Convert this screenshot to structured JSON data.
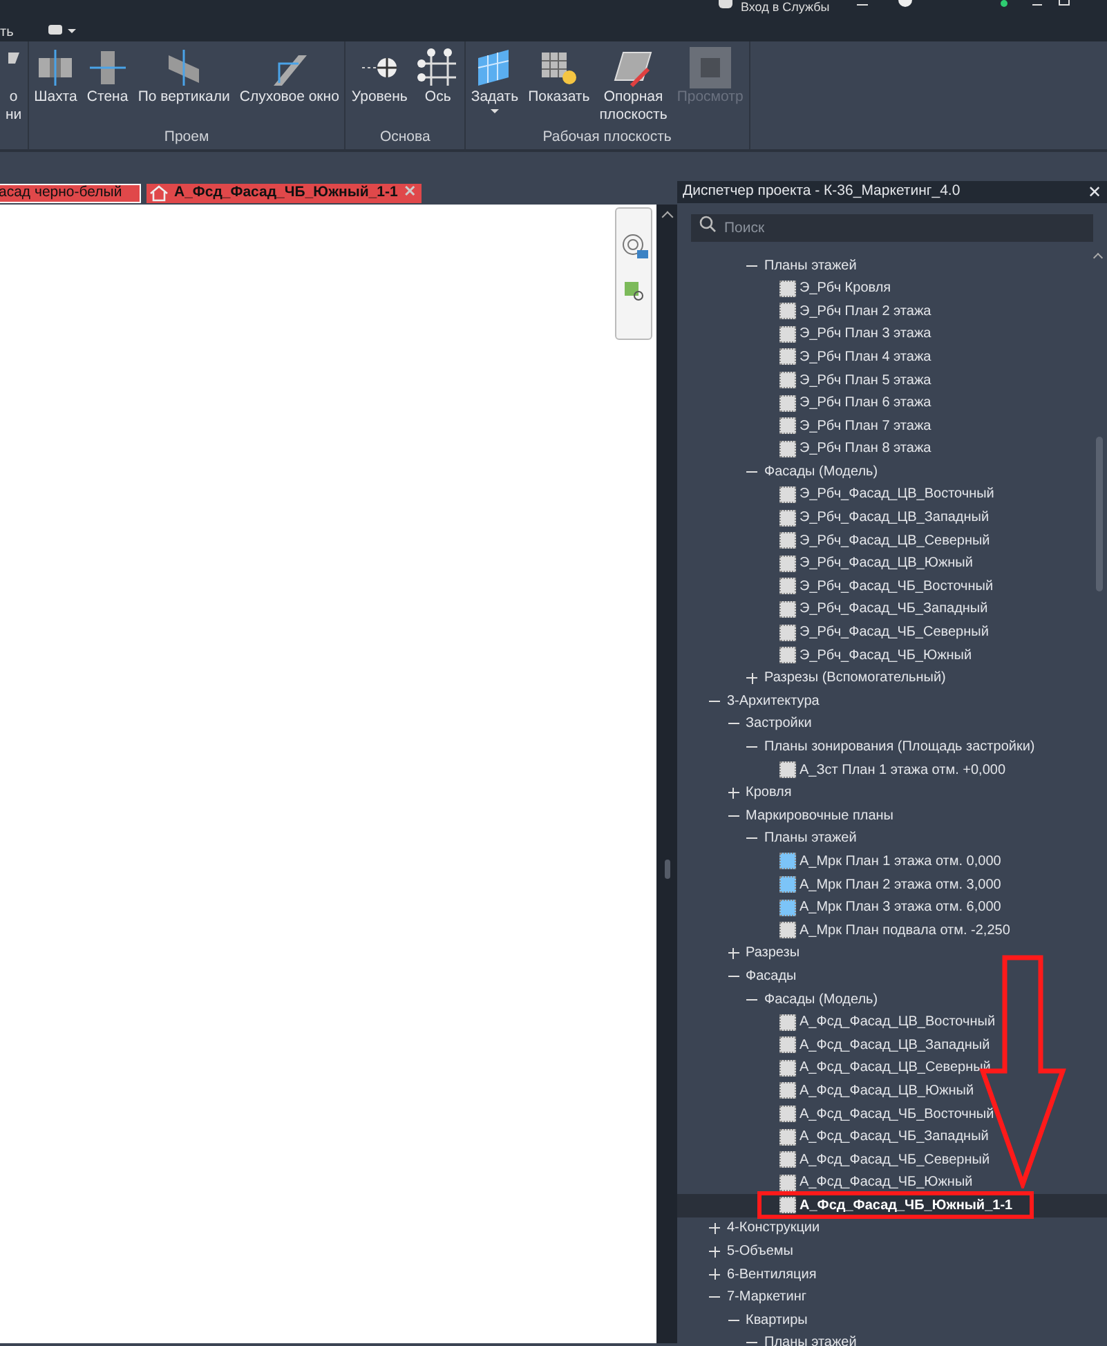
{
  "title_bar": {
    "menu_fragment": "ть",
    "sign_in": "Вход в Службы"
  },
  "ribbon": {
    "groups": [
      {
        "buttons": [
          {
            "lines": [
              "о",
              "ни"
            ],
            "disabled": false,
            "dropdown": false
          }
        ]
      },
      {
        "label": "Проем",
        "buttons": [
          {
            "lines": [
              "Шахта"
            ],
            "disabled": false,
            "dropdown": false
          },
          {
            "lines": [
              "Стена"
            ],
            "disabled": false,
            "dropdown": false
          },
          {
            "lines": [
              "По вертикали"
            ],
            "disabled": false,
            "dropdown": false
          },
          {
            "lines": [
              "Слуховое окно"
            ],
            "disabled": false,
            "dropdown": false
          }
        ]
      },
      {
        "label": "Основа",
        "buttons": [
          {
            "lines": [
              "Уровень"
            ],
            "disabled": false,
            "dropdown": false
          },
          {
            "lines": [
              "Ось"
            ],
            "disabled": false,
            "dropdown": false
          }
        ]
      },
      {
        "label": "Рабочая плоскость",
        "buttons": [
          {
            "lines": [
              "Задать"
            ],
            "disabled": false,
            "dropdown": true
          },
          {
            "lines": [
              "Показать"
            ],
            "disabled": false,
            "dropdown": false
          },
          {
            "lines": [
              "Опорная",
              "плоскость"
            ],
            "disabled": false,
            "dropdown": false
          },
          {
            "lines": [
              "Просмотр"
            ],
            "disabled": true,
            "dropdown": false
          }
        ]
      }
    ]
  },
  "doc_tabs": [
    {
      "label": "асад черно-белый",
      "selected": true,
      "home": false
    },
    {
      "label": "А_Фсд_Фасад_ЧБ_Южный_1-1",
      "selected": false,
      "home": true,
      "close": "✕"
    }
  ],
  "project_browser": {
    "title": "Диспетчер проекта - К-36_Маркетинг_4.0",
    "close": "✕",
    "search": {
      "placeholder": "Поиск"
    },
    "continued_items": [
      {
        "label": "Планы этажей",
        "kind": "folder",
        "expanded": true,
        "selected": false,
        "children": [
          {
            "label": "Э_Рбч Кровля",
            "kind": "view",
            "color": "#dcdcdc",
            "selected": false
          },
          {
            "label": "Э_Рбч План 2 этажа",
            "kind": "view",
            "color": "#dcdcdc",
            "selected": false
          },
          {
            "label": "Э_Рбч План 3 этажа",
            "kind": "view",
            "color": "#dcdcdc",
            "selected": false
          },
          {
            "label": "Э_Рбч План 4 этажа",
            "kind": "view",
            "color": "#dcdcdc",
            "selected": false
          },
          {
            "label": "Э_Рбч План 5 этажа",
            "kind": "view",
            "color": "#dcdcdc",
            "selected": false
          },
          {
            "label": "Э_Рбч План 6 этажа",
            "kind": "view",
            "color": "#dcdcdc",
            "selected": false
          },
          {
            "label": "Э_Рбч План 7 этажа",
            "kind": "view",
            "color": "#dcdcdc",
            "selected": false
          },
          {
            "label": "Э_Рбч План 8 этажа",
            "kind": "view",
            "color": "#dcdcdc",
            "selected": false
          }
        ]
      },
      {
        "label": "Фасады (Модель)",
        "kind": "folder",
        "expanded": true,
        "selected": false,
        "children": [
          {
            "label": "Э_Рбч_Фасад_ЦВ_Восточный",
            "kind": "view",
            "color": "#dcdcdc",
            "selected": false
          },
          {
            "label": "Э_Рбч_Фасад_ЦВ_Западный",
            "kind": "view",
            "color": "#dcdcdc",
            "selected": false
          },
          {
            "label": "Э_Рбч_Фасад_ЦВ_Северный",
            "kind": "view",
            "color": "#dcdcdc",
            "selected": false
          },
          {
            "label": "Э_Рбч_Фасад_ЦВ_Южный",
            "kind": "view",
            "color": "#dcdcdc",
            "selected": false
          },
          {
            "label": "Э_Рбч_Фасад_ЧБ_Восточный",
            "kind": "view",
            "color": "#dcdcdc",
            "selected": false
          },
          {
            "label": "Э_Рбч_Фасад_ЧБ_Западный",
            "kind": "view",
            "color": "#dcdcdc",
            "selected": false
          },
          {
            "label": "Э_Рбч_Фасад_ЧБ_Северный",
            "kind": "view",
            "color": "#dcdcdc",
            "selected": false
          },
          {
            "label": "Э_Рбч_Фасад_ЧБ_Южный",
            "kind": "view",
            "color": "#dcdcdc",
            "selected": false
          }
        ]
      },
      {
        "label": "Разрезы (Вспомогательный)",
        "kind": "folder",
        "expanded": false,
        "selected": false
      }
    ],
    "items": [
      {
        "label": "3-Архитектура",
        "kind": "folder",
        "expanded": true,
        "selected": false,
        "children": [
          {
            "label": "Застройки",
            "kind": "folder",
            "expanded": true,
            "selected": false,
            "children": [
              {
                "label": "Планы зонирования (Площадь застройки)",
                "kind": "folder",
                "expanded": true,
                "selected": false,
                "children": [
                  {
                    "label": "А_Зст План 1 этажа отм. +0,000",
                    "kind": "view",
                    "color": "#dcdcdc",
                    "selected": false
                  }
                ]
              }
            ]
          },
          {
            "label": "Кровля",
            "kind": "folder",
            "expanded": false,
            "selected": false
          },
          {
            "label": "Маркировочные планы",
            "kind": "folder",
            "expanded": true,
            "selected": false,
            "children": [
              {
                "label": "Планы этажей",
                "kind": "folder",
                "expanded": true,
                "selected": false,
                "children": [
                  {
                    "label": "А_Мрк План 1 этажа отм. 0,000",
                    "kind": "view",
                    "color": "#7cc4f8",
                    "selected": false
                  },
                  {
                    "label": "А_Мрк План 2 этажа отм. 3,000",
                    "kind": "view",
                    "color": "#7cc4f8",
                    "selected": false
                  },
                  {
                    "label": "А_Мрк План 3 этажа отм. 6,000",
                    "kind": "view",
                    "color": "#7cc4f8",
                    "selected": false
                  },
                  {
                    "label": "А_Мрк План подвала отм. -2,250",
                    "kind": "view",
                    "color": "#dcdcdc",
                    "selected": false
                  }
                ]
              }
            ]
          },
          {
            "label": "Разрезы",
            "kind": "folder",
            "expanded": false,
            "selected": false
          },
          {
            "label": "Фасады",
            "kind": "folder",
            "expanded": true,
            "selected": false,
            "children": [
              {
                "label": "Фасады (Модель)",
                "kind": "folder",
                "expanded": true,
                "selected": false,
                "children": [
                  {
                    "label": "А_Фсд_Фасад_ЦВ_Восточный",
                    "kind": "view",
                    "color": "#dcdcdc",
                    "selected": false
                  },
                  {
                    "label": "А_Фсд_Фасад_ЦВ_Западный",
                    "kind": "view",
                    "color": "#dcdcdc",
                    "selected": false
                  },
                  {
                    "label": "А_Фсд_Фасад_ЦВ_Северный",
                    "kind": "view",
                    "color": "#dcdcdc",
                    "selected": false
                  },
                  {
                    "label": "А_Фсд_Фасад_ЦВ_Южный",
                    "kind": "view",
                    "color": "#dcdcdc",
                    "selected": false
                  },
                  {
                    "label": "А_Фсд_Фасад_ЧБ_Восточный",
                    "kind": "view",
                    "color": "#dcdcdc",
                    "selected": false
                  },
                  {
                    "label": "А_Фсд_Фасад_ЧБ_Западный",
                    "kind": "view",
                    "color": "#dcdcdc",
                    "selected": false
                  },
                  {
                    "label": "А_Фсд_Фасад_ЧБ_Северный",
                    "kind": "view",
                    "color": "#dcdcdc",
                    "selected": false
                  },
                  {
                    "label": "А_Фсд_Фасад_ЧБ_Южный",
                    "kind": "view",
                    "color": "#dcdcdc",
                    "selected": false
                  },
                  {
                    "label": "А_Фсд_Фасад_ЧБ_Южный_1-1",
                    "kind": "view",
                    "color": "#dcdcdc",
                    "selected": true
                  }
                ]
              }
            ]
          }
        ]
      },
      {
        "label": "4-Конструкции",
        "kind": "folder",
        "expanded": false,
        "selected": false
      },
      {
        "label": "5-Объемы",
        "kind": "folder",
        "expanded": false,
        "selected": false
      },
      {
        "label": "6-Вентиляция",
        "kind": "folder",
        "expanded": false,
        "selected": false
      },
      {
        "label": "7-Маркетинг",
        "kind": "folder",
        "expanded": true,
        "selected": false,
        "children": [
          {
            "label": "Квартиры",
            "kind": "folder",
            "expanded": true,
            "selected": false,
            "children": [
              {
                "label": "Планы этажей",
                "kind": "folder",
                "expanded": true,
                "selected": false
              }
            ]
          }
        ]
      }
    ]
  }
}
